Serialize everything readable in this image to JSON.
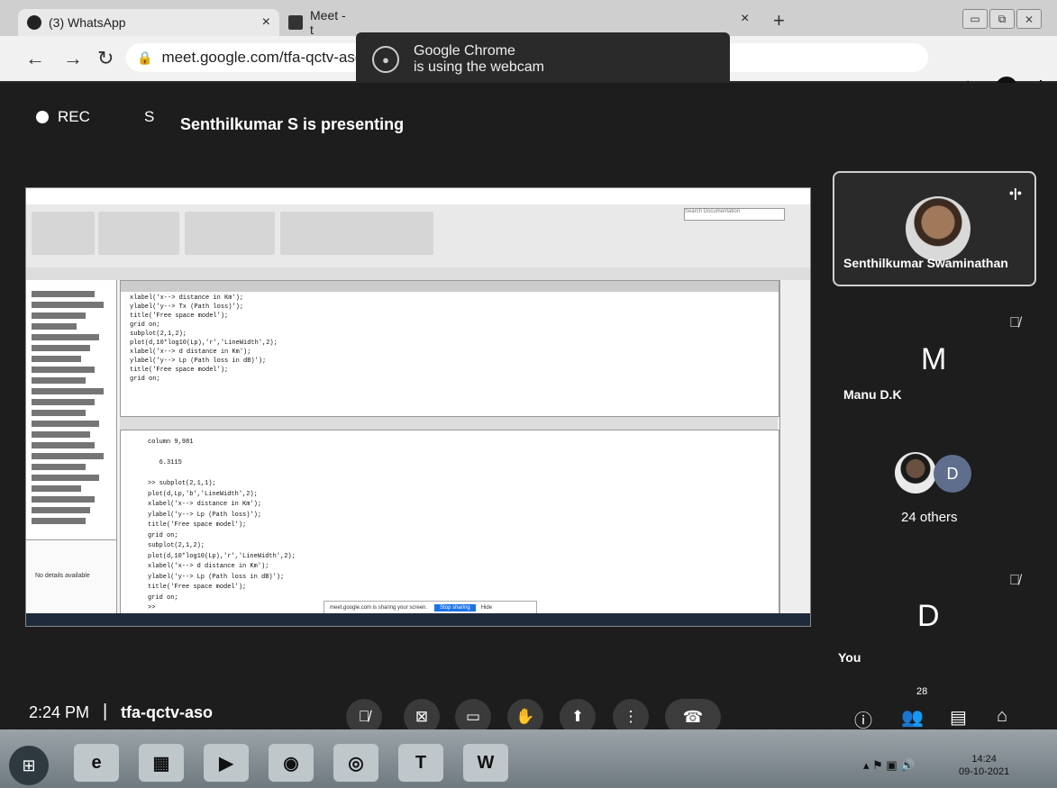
{
  "browser": {
    "tabs": [
      {
        "label": "(3) WhatsApp"
      },
      {
        "label": "Meet - t"
      }
    ],
    "new_tab_glyph": "+",
    "close_glyph": "×",
    "url": "meet.google.com/tfa-qctv-aso",
    "profile_initial": "D",
    "window_buttons": [
      "▭",
      "⧉",
      "⨯"
    ]
  },
  "notification": {
    "line1": "Google Chrome",
    "line2": "is using the webcam"
  },
  "meet": {
    "rec_label": "REC",
    "presenter_initial": "S",
    "presenting_text": "Senthilkumar S is presenting",
    "tiles": {
      "main_name": "Senthilkumar Swaminathan",
      "second_letter": "M",
      "second_name": "Manu D.K",
      "others_initial": "D",
      "others_text": "24 others",
      "you_letter": "D",
      "you_name": "You"
    },
    "bottom": {
      "time": "2:24 PM",
      "separator": "|",
      "meeting_code": "tfa-qctv-aso",
      "participants_count": "28"
    }
  },
  "shared_screen": {
    "share_bar_text": "meet.google.com is sharing your screen.",
    "stop_label": "Stop sharing",
    "hide_label": "Hide",
    "search_placeholder": "Search Documentation",
    "no_details": "No details available",
    "editor_code": "xlabel('x--> distance in Km');\nylabel('y--> Tx (Path loss)');\ntitle('Free space model');\ngrid on;\nsubplot(2,1,2);\nplot(d,10*log10(Lp),'r','LineWidth',2);\nxlabel('x--> d distance in Km');\nylabel('y--> Lp (Path loss in dB)');\ntitle('Free space model');\ngrid on;",
    "cmd_code": "column 9,981\n\n   6.3115\n\n>> subplot(2,1,1);\nplot(d,Lp,'b','LineWidth',2);\nxlabel('x--> distance in Km');\nylabel('y--> Lp (Path loss)');\ntitle('Free space model');\ngrid on;\nsubplot(2,1,2);\nplot(d,10*log10(Lp),'r','LineWidth',2);\nxlabel('x--> d distance in Km');\nylabel('y--> Lp (Path loss in dB)');\ntitle('Free space model');\ngrid on;\n>>"
  },
  "taskbar": {
    "clock": "14:24",
    "date": "09-10-2021",
    "word_label": "W"
  }
}
